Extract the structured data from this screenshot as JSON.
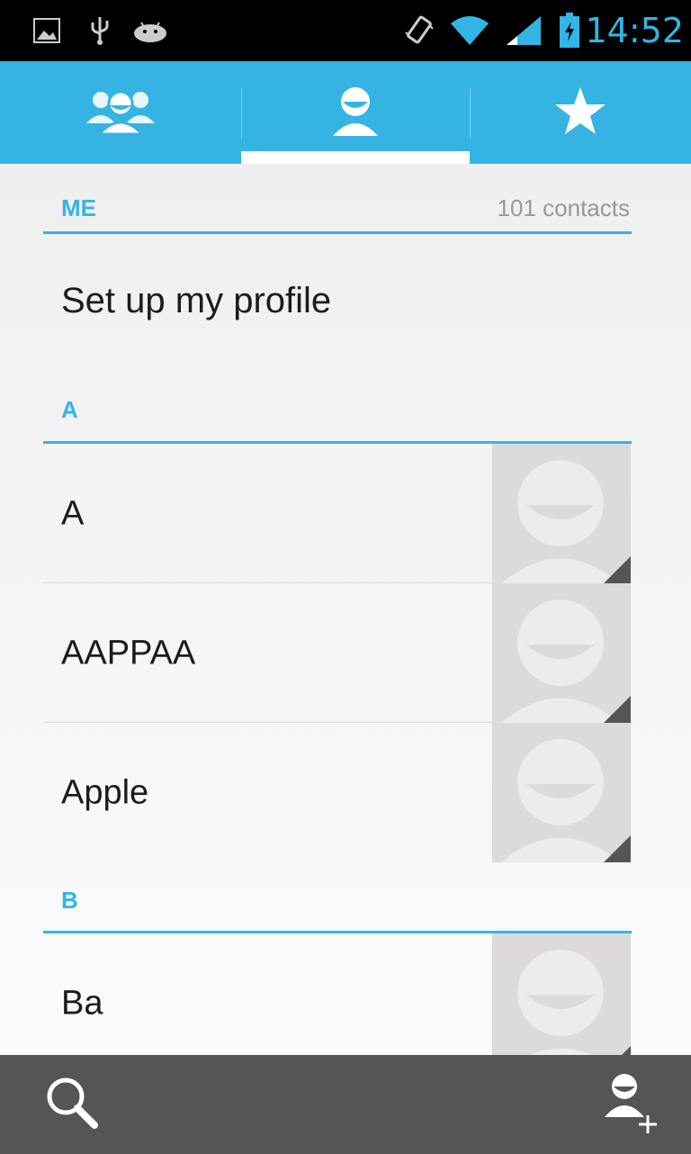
{
  "status_bar": {
    "time": "14:52",
    "icons": [
      "image-notification-icon",
      "usb-icon",
      "android-debug-icon",
      "vibrate-icon",
      "wifi-icon",
      "signal-icon",
      "battery-charging-icon"
    ]
  },
  "tabs": [
    {
      "name": "groups",
      "icon": "groups-icon"
    },
    {
      "name": "all-contacts",
      "icon": "person-icon",
      "selected": true
    },
    {
      "name": "favorites",
      "icon": "star-icon"
    }
  ],
  "me_section": {
    "label": "ME",
    "count_text": "101 contacts",
    "profile_text": "Set up my profile"
  },
  "sections": [
    {
      "letter": "A",
      "contacts": [
        {
          "name": "A"
        },
        {
          "name": "AAPPAA"
        },
        {
          "name": "Apple"
        }
      ]
    },
    {
      "letter": "B",
      "contacts": [
        {
          "name": "Ba"
        }
      ]
    }
  ],
  "bottom_bar": {
    "search_icon": "search-icon",
    "add_contact_icon": "add-contact-icon"
  },
  "colors": {
    "accent": "#33b5e5",
    "tab_bar": "#35b4e4",
    "bottom_bar": "#555555"
  }
}
